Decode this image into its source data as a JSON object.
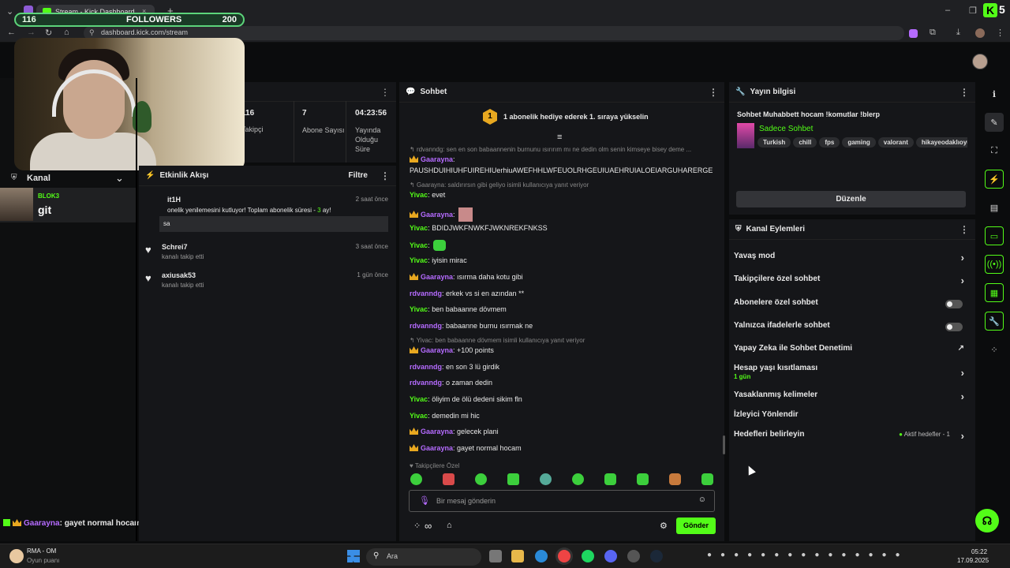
{
  "browser": {
    "tab_title": "Stream - Kick Dashboard",
    "url": "dashboard.kick.com/stream",
    "new_tab": "+"
  },
  "overlay": {
    "followers_current": "116",
    "followers_label": "FOLLOWERS",
    "followers_goal": "200",
    "corner_logo": "K",
    "corner_count": "5"
  },
  "left": {
    "kanal_label": "Kanal",
    "raid_user": "BLOK3",
    "raid_text": "git",
    "chat_overlay_user": "Gaarayna",
    "chat_overlay_text": ": gayet normal hocam"
  },
  "stats": {
    "items": [
      {
        "value": "116",
        "label": "Takipçi"
      },
      {
        "value": "7",
        "label": "Abone Sayısı"
      },
      {
        "value": "04:23:56",
        "label": "Yayında Olduğu Süre"
      }
    ]
  },
  "activity": {
    "title": "Etkinlik Akışı",
    "filter": "Filtre",
    "events": [
      {
        "user": "it1H",
        "time": "2 saat önce",
        "desc": "onelik yenilemesini kutluyor! Toplam abonelik süresi - ",
        "months": "3",
        "months_suffix": " ay!",
        "message": "sa"
      },
      {
        "user": "Schrei7",
        "time": "3 saat önce",
        "desc": "kanalı takip etti"
      },
      {
        "user": "axiusak53",
        "time": "1 gün önce",
        "desc": "kanalı takip etti"
      }
    ]
  },
  "chat": {
    "title": "Sohbet",
    "pinned": "1 abonelik hediye ederek 1. sıraya yükselin",
    "pinned_badge": "1",
    "lines": [
      {
        "type": "reply",
        "text": "rdvanndg: sen en son babaannenin burnunu ısırırım mı ne dedin olm senin kimseye bisey deme ..."
      },
      {
        "user": "Gaarayna",
        "color": "purple",
        "crown": true,
        "text": ":"
      },
      {
        "user": "",
        "text": "PAUSHDUIHIUHFUIREHIUerhiuAWEFHHLWFEUOLRHGEUIUAEHRUIALOEIARGUHARERGE"
      },
      {
        "type": "reply",
        "text": "Gaarayna: saldırırsın gibi geliyo isimli kullanıcıya yanıt veriyor"
      },
      {
        "user": "Yivac",
        "color": "green",
        "text": ": evet"
      },
      {
        "user": "Gaarayna",
        "color": "purple",
        "crown": true,
        "text": ":"
      },
      {
        "user": "Yivac",
        "color": "green",
        "text": ": BDIDJWKFNWKFJWKNREKFNKSS"
      },
      {
        "user": "Yivac",
        "color": "green",
        "text": ":"
      },
      {
        "user": "Yivac",
        "color": "green",
        "text": ": iyisin mirac"
      },
      {
        "user": "Gaarayna",
        "color": "purple",
        "crown": true,
        "text": ": ısırma daha kotu gibi"
      },
      {
        "user": "rdvanndg",
        "color": "purple",
        "text": ": erkek vs si en azından **"
      },
      {
        "user": "Yivac",
        "color": "green",
        "text": ": ben babaanne dövmem"
      },
      {
        "user": "rdvanndg",
        "color": "purple",
        "text": ": babaanne burnu ısırmak ne"
      },
      {
        "type": "reply",
        "text": "Yivac: ben babaanne dövmem isimli kullanıcıya yanıt veriyor"
      },
      {
        "user": "Gaarayna",
        "color": "purple",
        "crown": true,
        "text": ": +100 points"
      },
      {
        "user": "rdvanndg",
        "color": "purple",
        "text": ": en son 3 lü girdik"
      },
      {
        "user": "rdvanndg",
        "color": "purple",
        "text": ": o zaman dedin"
      },
      {
        "user": "Yivac",
        "color": "green",
        "text": ": öliyim de ölü dedeni sikim fln"
      },
      {
        "user": "Yivac",
        "color": "green",
        "text": ": demedin mi hic"
      },
      {
        "user": "Gaarayna",
        "color": "purple",
        "crown": true,
        "text": ": gelecek plani"
      },
      {
        "user": "Gaarayna",
        "color": "purple",
        "crown": true,
        "text": ": gayet normal hocam"
      }
    ],
    "followers_only_label": "Takipçilere Özel",
    "input_placeholder": "Bir mesaj gönderin",
    "send_label": "Gönder"
  },
  "stream_info": {
    "title": "Yayın bilgisi",
    "stream_title": "Sohbet Muhabbett hocam !komutlar !blerp",
    "category": "Sadece Sohbet",
    "tags": [
      "Turkish",
      "chill",
      "fps",
      "gaming",
      "valorant",
      "hikayeodaklıoyu"
    ],
    "edit_label": "Düzenle"
  },
  "channel_actions": {
    "title": "Kanal Eylemleri",
    "rows": [
      {
        "label": "Yavaş mod",
        "control": "chevron"
      },
      {
        "label": "Takipçilere özel sohbet",
        "control": "chevron"
      },
      {
        "label": "Abonelere özel sohbet",
        "control": "toggle"
      },
      {
        "label": "Yalnızca ifadelerle sohbet",
        "control": "toggle"
      },
      {
        "label": "Yapay Zeka ile Sohbet Denetimi",
        "control": "external"
      },
      {
        "label": "Hesap yaşı kısıtlaması",
        "sub": "1 gün",
        "control": "chevron"
      },
      {
        "label": "Yasaklanmış kelimeler",
        "control": "chevron"
      },
      {
        "label": "İzleyici Yönlendir",
        "control": "none"
      },
      {
        "label": "Hedefleri belirleyin",
        "control": "chevron",
        "status": "Aktif hedefler - 1"
      }
    ]
  },
  "taskbar": {
    "media_title": "RMA - OM",
    "media_sub": "Oyun puanı",
    "search": "Ara",
    "time": "05:22",
    "date": "17.09.2025"
  },
  "colors": {
    "kick_green": "#53fc18",
    "purple_user": "#b56bff",
    "crown": "#e8a820"
  }
}
